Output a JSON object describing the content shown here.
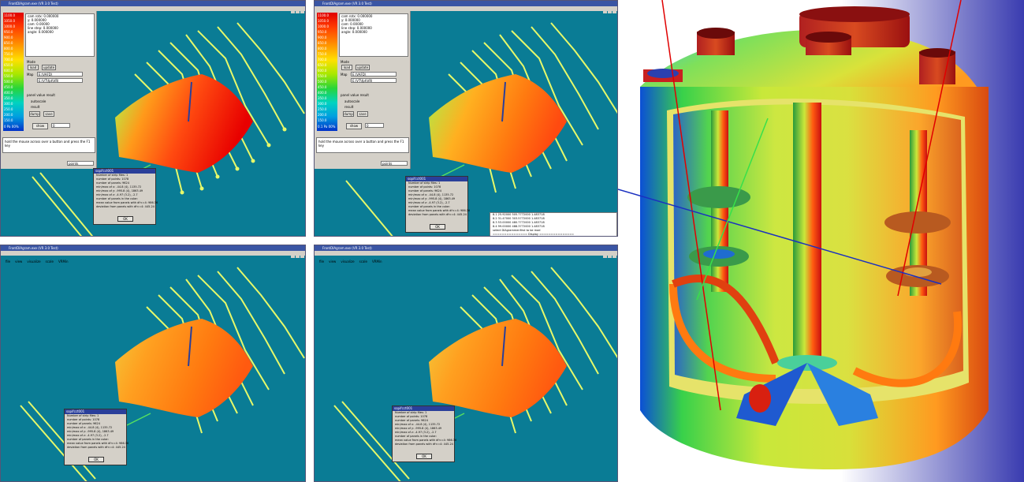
{
  "panels": [
    {
      "title": "FrontDIAgram.exe (VR 3.0 Test)",
      "menu": [
        "file",
        "view",
        "visualize",
        "scale",
        "VRMin"
      ],
      "dialog": {
        "title": "sopifcct001",
        "lines": [
          "Number of strip files: 1",
          "number of points:   1078",
          "number of panels:   9624",
          "min/max of x:    -44.8 (4), 1135.72",
          "min/max of y:    -995.8 (4), 1863.49",
          "min/max of z:    -4.97 (3.2), -2.7",
          "number of panels in the cube:",
          "mean value from panels with df<=4:  986.36",
          "deviation  from panels with df<=4:  445.24"
        ],
        "ok": "OK"
      },
      "ctrl": {
        "ticks": [
          "1100.0",
          "1050.0",
          "1000.0",
          "950.0",
          "900.0",
          "850.0",
          "800.0",
          "750.0",
          "700.0",
          "650.0",
          "600.0",
          "550.0",
          "500.0",
          "450.0",
          "400.0",
          "350.0",
          "300.0",
          "250.0",
          "200.0",
          "150.0",
          "0 Pa 00%"
        ],
        "info": [
          "cam rotx:  0.000000",
          "y:    0.000000",
          "cam:  0.00000",
          "",
          "line step:  0.000000",
          "angle:  0.000000"
        ],
        "buttons": [
          "load",
          "update",
          "show",
          "dump",
          "save"
        ],
        "labels": [
          "Mode",
          "Map",
          "panel value  result",
          "autoscale",
          "result",
          "0"
        ],
        "fields": [
          "E:\\VAFD\\",
          "E:\\VT\\fpt\\VRl"
        ],
        "hint": "hold the mouse across over a button and press the F1 key",
        "select": "points"
      }
    },
    {
      "title": "FrontDIAgram.exe (VR 3.0 Test)",
      "menu": [
        "file",
        "view",
        "visualize",
        "scale",
        "VRMin"
      ],
      "dialog": {
        "title": "sopifcct001",
        "lines": [
          "Number of strip files: 1",
          "number of points:   1078",
          "number of panels:   9624",
          "min/max of x:    -44.8 (4), 1135.72",
          "min/max of y:    -995.8 (4), 1863.49",
          "min/max of z:    -4.97 (3.2), -2.7",
          "number of panels in the cube:",
          "mean value from panels with df<=4:  986.36",
          "deviation  from panels with df<=4:  445.24"
        ],
        "ok": "OK"
      },
      "ctrl": {
        "ticks": [
          "1100.0",
          "1050.0",
          "1000.0",
          "950.0",
          "900.0",
          "850.0",
          "800.0",
          "750.0",
          "700.0",
          "650.0",
          "600.0",
          "550.0",
          "500.0",
          "450.0",
          "400.0",
          "350.0",
          "300.0",
          "250.0",
          "200.0",
          "150.0",
          "0.1 Pa 00%"
        ],
        "info": [
          "cam rotx:  0.000000",
          "y:    0.000000",
          "cam:  0.00000",
          "",
          "line step:  0.000000",
          "angle:  0.000000"
        ],
        "buttons": [
          "load",
          "update",
          "show",
          "dump",
          "save"
        ],
        "labels": [
          "Mode",
          "Map",
          "panel value  result",
          "autoscale",
          "result",
          "0"
        ],
        "fields": [
          "E:\\VAFD\\",
          "E:\\VT\\fpt\\VRl"
        ],
        "hint": "hold the mouse across over a button and press the F1 key",
        "select": "points"
      },
      "output": [
        "8.1   25.92000    505.7772000    1.483718",
        "8.2   31.47000    303.5772000    1.483718",
        "8.3   53.00000    480.7772000    1.483718",
        "8.4   99.00000    488.3772000    1.483718",
        "select DIAgrammenfirst to be mad",
        "=============== Display ==============="
      ]
    },
    {
      "title": "FrontDIAgram.exe (VR 3.0 Test)",
      "menu": [
        "file",
        "view",
        "visualize",
        "scale",
        "VRMin"
      ],
      "dialog": {
        "title": "sopifcct001",
        "lines": [
          "Number of strip files: 1",
          "number of points:   1078",
          "number of panels:   9624",
          "min/max of x:    -44.8 (4), 1135.72",
          "min/max of y:    -995.8 (4), 1863.49",
          "min/max of z:    -4.97 (3.2), -2.7",
          "number of panels in the cube:",
          "mean value from panels with df<=4:  986.36",
          "deviation  from panels with df<=4:  445.24"
        ],
        "ok": "OK"
      }
    },
    {
      "title": "FrontDIAgram.exe (VR 3.0 Test)",
      "menu": [
        "file",
        "view",
        "visualize",
        "scale",
        "VRMin"
      ],
      "dialog": {
        "title": "sopifcct001",
        "lines": [
          "Number of strip files: 1",
          "number of points:   1078",
          "number of panels:   9624",
          "min/max of x:    -44.8 (4), 1135.72",
          "min/max of y:    -995.8 (4), 1863.49",
          "min/max of z:    -4.97 (3.2), -2.7",
          "number of panels in the cube:",
          "mean value from panels with df<=4:  986.36",
          "deviation  from panels with df<=4:  445.24"
        ],
        "ok": "OK"
      }
    }
  ],
  "colors": {
    "viewport_bg": "#0a7c95",
    "surface_hot": "#ff2a00",
    "surface_warm": "#ffa500",
    "vector_lines": "#e6f96a",
    "vessel_bg_left": "#ffffff",
    "vessel_bg_right": "#3a3cb0"
  }
}
